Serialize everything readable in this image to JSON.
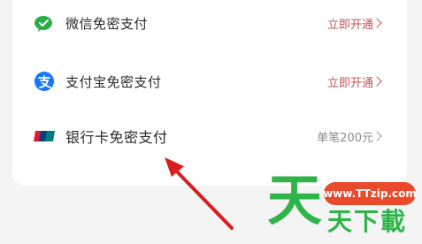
{
  "payments": [
    {
      "label": "微信免密支付",
      "action": "立即开通",
      "icon": "wechat-icon"
    },
    {
      "label": "支付宝免密支付",
      "action": "立即开通",
      "icon": "alipay-icon"
    },
    {
      "label": "银行卡免密支付",
      "action": "单笔200元",
      "icon": "unionpay-icon"
    }
  ],
  "colors": {
    "wechat": "#2aae4a",
    "alipay": "#1677ff",
    "action": "#c2534c",
    "arrow": "#d81f1f"
  },
  "watermark": {
    "site": "www.TTzip.com",
    "big": "天",
    "small": "天下載"
  }
}
